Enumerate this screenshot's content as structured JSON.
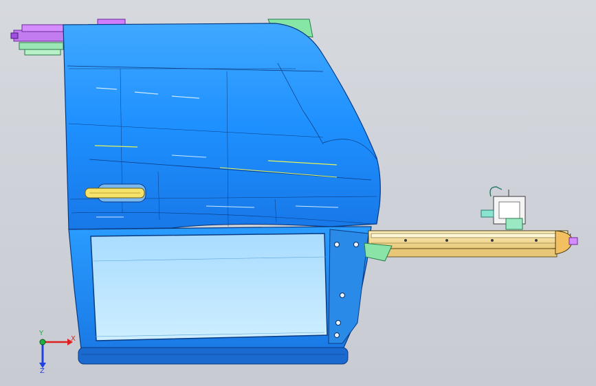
{
  "viewport": {
    "background_color": "#d2d6dc"
  },
  "model": {
    "door_panel_color": "#1e90ff",
    "window_glass_color": "#b9e3ff",
    "hinge_color": "#c060ff",
    "mount_color": "#7ee0a0",
    "rail_color": "#f2d38a",
    "handle_color": "#f5e26a"
  },
  "triad": {
    "x_label": "X",
    "y_label": "Y",
    "z_label": "Z",
    "x_color": "#e02020",
    "y_color": "#20b040",
    "z_color": "#2040e0"
  }
}
